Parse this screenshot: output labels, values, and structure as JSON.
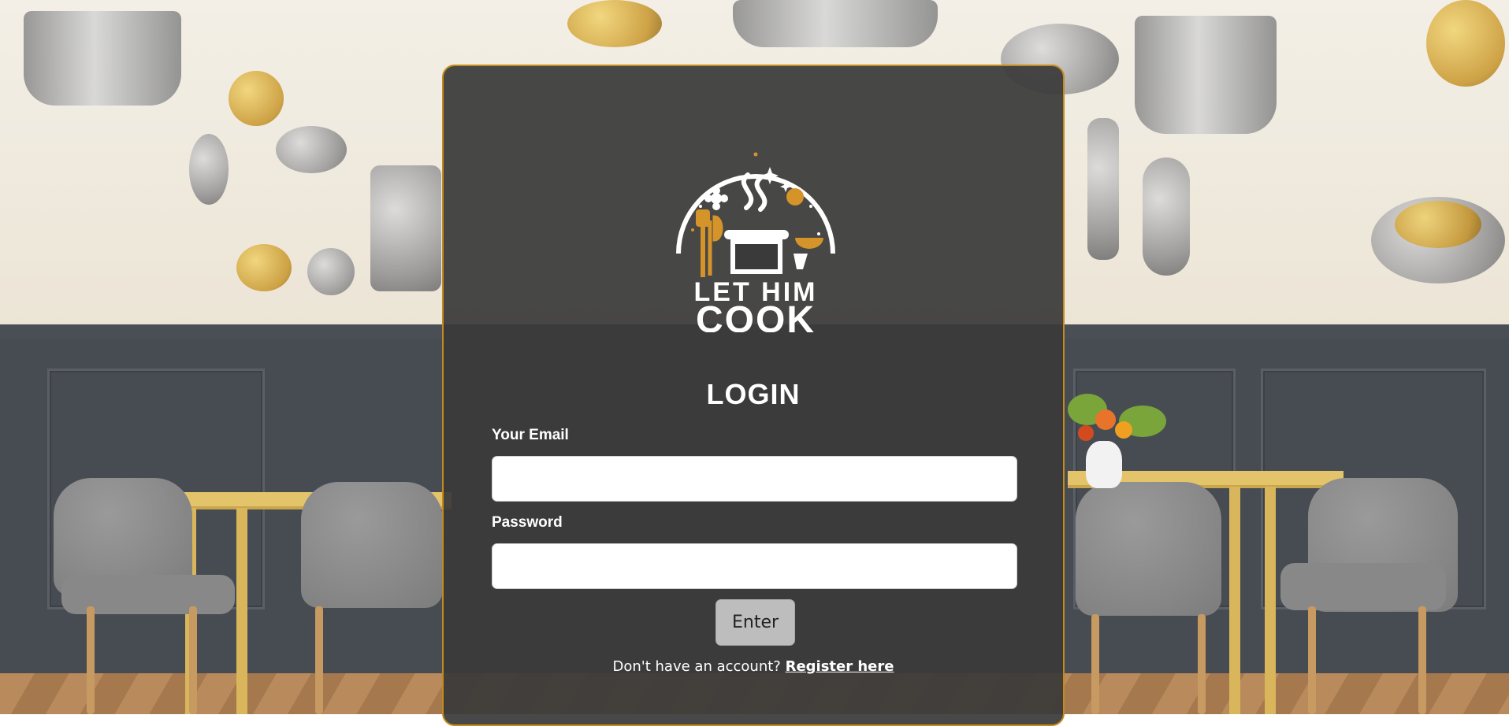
{
  "brand": {
    "logo_line1": "LET HIM",
    "logo_line2": "COOK",
    "accent_color": "#c48a1b"
  },
  "login": {
    "title": "LOGIN",
    "email_label": "Your Email",
    "email_value": "",
    "password_label": "Password",
    "password_value": "",
    "submit_label": "Enter",
    "register_prompt": "Don't have an account?",
    "register_link": "Register here"
  },
  "icons": [
    "chef-pot-logo-icon",
    "steam-icon",
    "spatula-icon",
    "sparkle-icon"
  ]
}
